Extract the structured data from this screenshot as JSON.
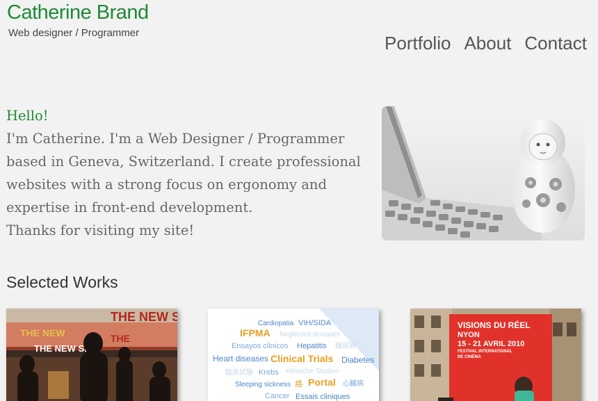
{
  "header": {
    "name": "Catherine Brand",
    "tagline": "Web designer / Programmer"
  },
  "nav": {
    "items": [
      {
        "label": "Portfolio"
      },
      {
        "label": "About"
      },
      {
        "label": "Contact"
      }
    ]
  },
  "intro": {
    "greeting": "Hello!",
    "lines": [
      "I'm Catherine. I'm a Web Designer / Programmer",
      "based in Geneva, Switzerland. I create professional",
      "websites with a strong focus on ergonomy and",
      "expertise in front-end development.",
      "Thanks for visiting my site!"
    ]
  },
  "works": {
    "title": "Selected Works",
    "thumb_2_words": [
      "Cardiopatia",
      "VIH/SIDA",
      "IFPMA",
      "Neglected diseases",
      "Ensayos clinicos",
      "Hepatitis",
      "糖尿病",
      "Heart diseases",
      "Clinical Trials",
      "Diabetes",
      "臨床試験",
      "Krebs",
      "Klinische Studien",
      "Sleeping sickness",
      "癌",
      "Portal",
      "心臓病",
      "Cancer",
      "Essais cliniques"
    ],
    "thumb_3_poster": {
      "line1": "VISIONS DU RÉEL",
      "line2": "NYON",
      "line3": "15 - 21 AVRIL 2010",
      "line4": "FESTIVAL INTERNATIONAL",
      "line5": "DE CINÉMA"
    },
    "thumb_1_sign": "THE NEW S"
  },
  "colors": {
    "background": "#f2f2f2",
    "accent_green": "#1f8a35",
    "text_gray": "#666666",
    "poster_red": "#e0322a",
    "tag_blue": "#4a86c8",
    "tag_orange": "#e8a020"
  }
}
